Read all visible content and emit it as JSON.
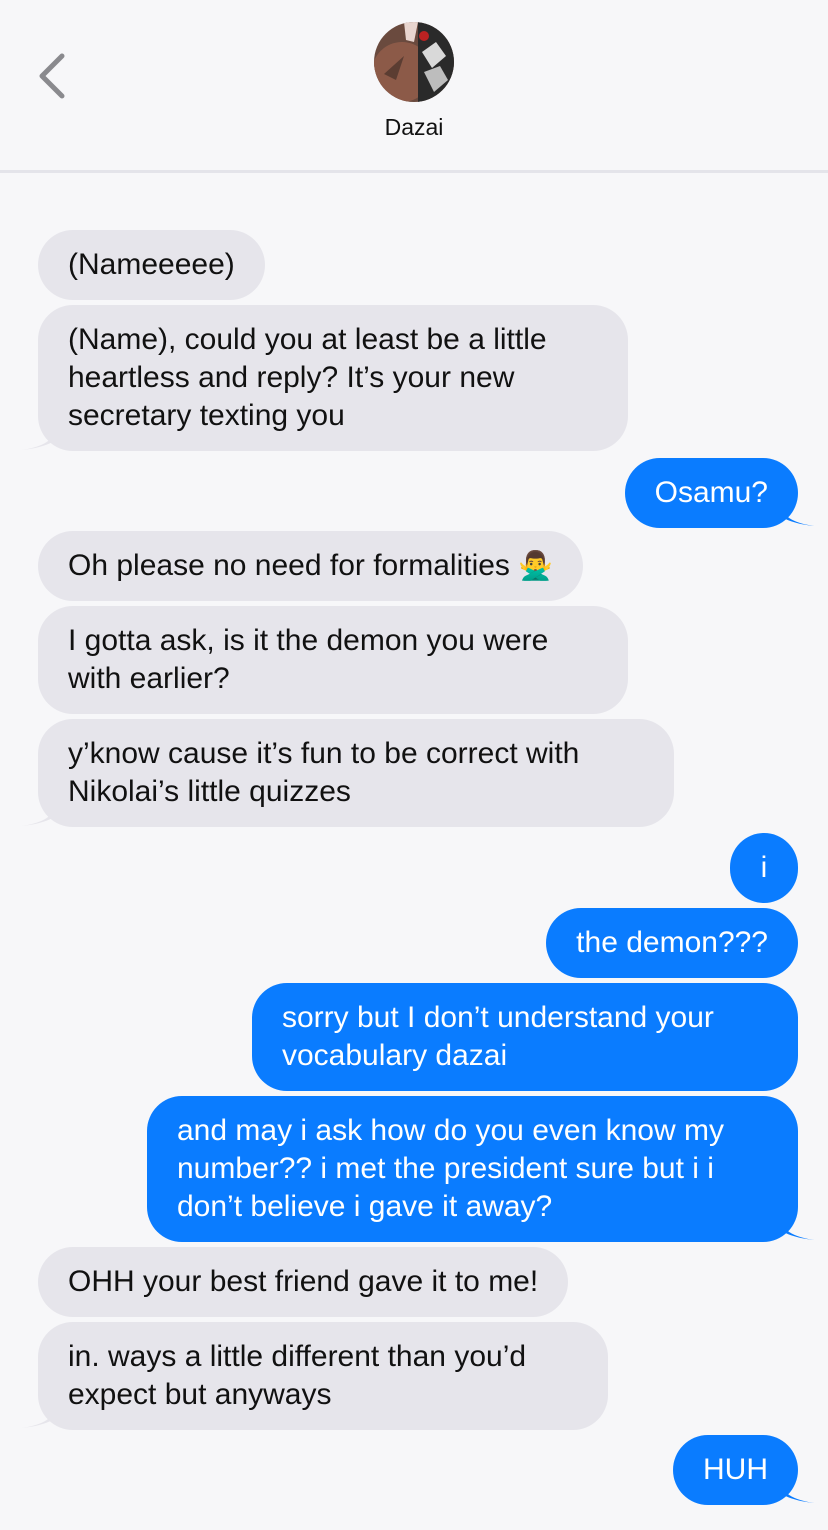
{
  "header": {
    "back_icon": "chevron-left-icon",
    "contact_name": "Dazai"
  },
  "colors": {
    "incoming_bubble": "#e6e5eb",
    "outgoing_bubble": "#0a7cff",
    "background": "#f7f7f9"
  },
  "messages": [
    {
      "from": "them",
      "text": "(Nameeeee)"
    },
    {
      "from": "them",
      "lines": [
        "(Name), could you at least be a little",
        "heartless and reply? It’s your new",
        "secretary texting you"
      ]
    },
    {
      "from": "me",
      "text": "Osamu?"
    },
    {
      "from": "them",
      "text": "Oh please no need for formalities",
      "emoji": "🙅‍♂️"
    },
    {
      "from": "them",
      "lines": [
        "I gotta ask, is it the demon you were",
        "with earlier?"
      ]
    },
    {
      "from": "them",
      "lines": [
        "y’know cause it’s fun to be correct with",
        "Nikolai’s little quizzes"
      ]
    },
    {
      "from": "me",
      "text": "i"
    },
    {
      "from": "me",
      "text": "the demon???"
    },
    {
      "from": "me",
      "lines": [
        "sorry but I don’t understand your",
        "vocabulary dazai"
      ]
    },
    {
      "from": "me",
      "lines": [
        "and may i ask how do you even know my",
        "number?? i met the president sure but i i",
        "don’t believe i gave it away?"
      ]
    },
    {
      "from": "them",
      "text": "OHH your best friend gave it to me!"
    },
    {
      "from": "them",
      "lines": [
        "in. ways a little different than you’d",
        "expect but anyways"
      ]
    },
    {
      "from": "me",
      "text": "HUH"
    }
  ]
}
